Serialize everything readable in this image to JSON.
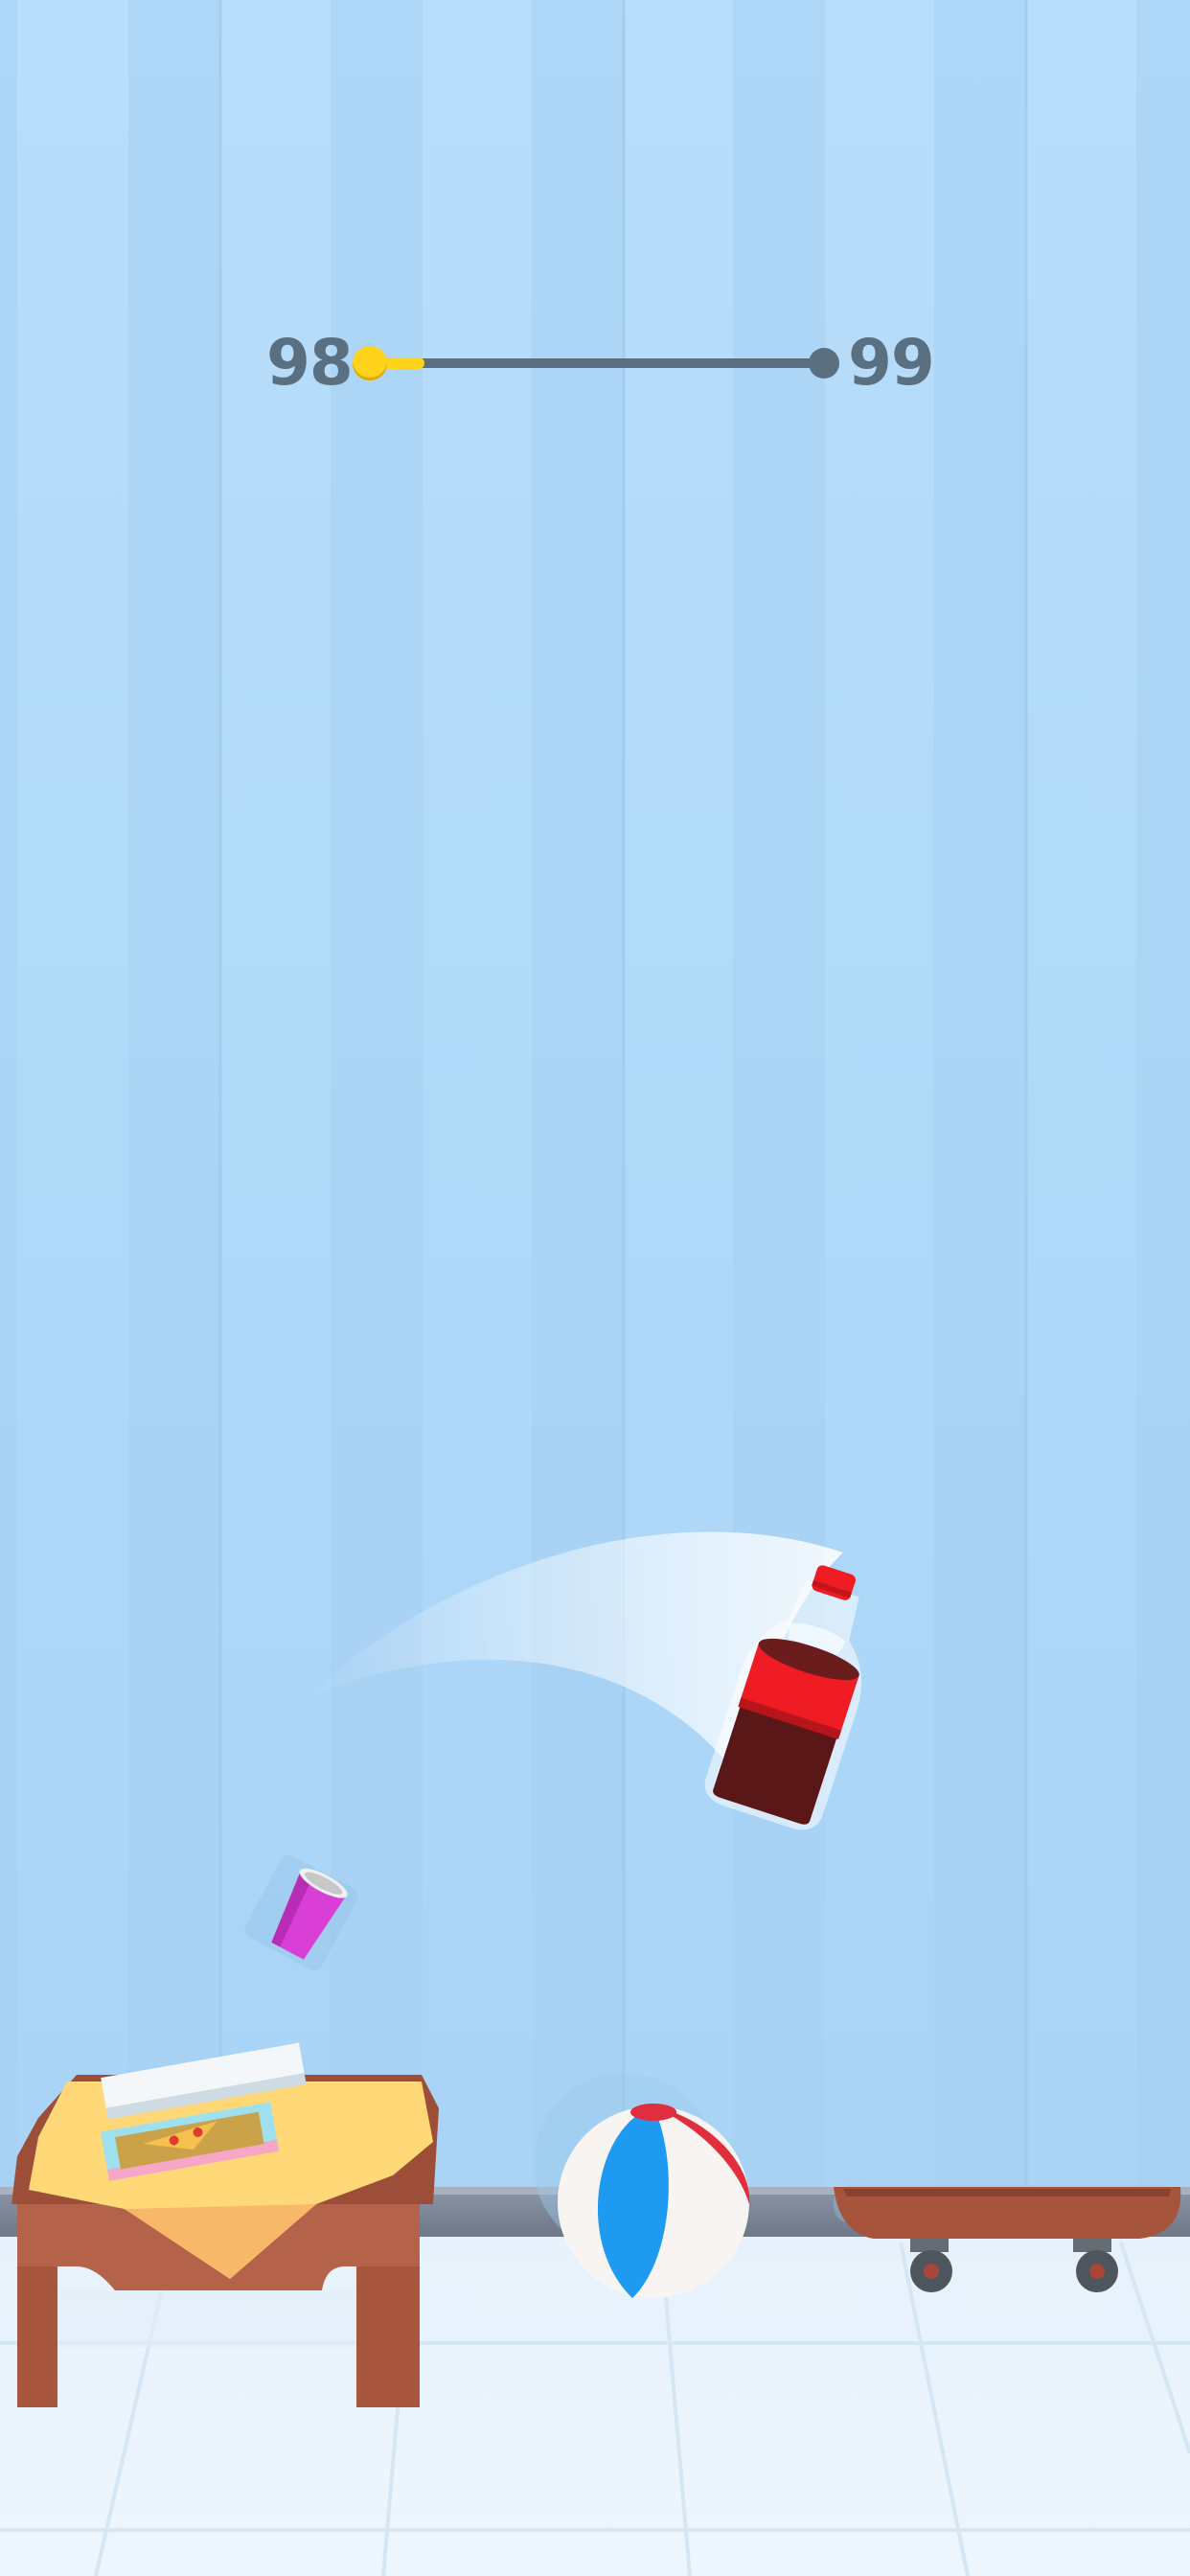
{
  "hud": {
    "current_level": "98",
    "next_level": "99",
    "progress_fraction": 0.12
  },
  "colors": {
    "wall": "#b9e0fb",
    "floor": "#eaf3fb",
    "progress_track": "#5a6f80",
    "progress_fill": "#ffd21c",
    "bottle_label": "#ef1c24",
    "cola": "#5a1717",
    "cup": "#d93fd6",
    "table": "#b4624a",
    "tablecloth": "#ffdb73",
    "skateboard": "#a6543b",
    "ball_blue": "#1e9bf0",
    "ball_red": "#e02e3f"
  },
  "scene": {
    "player": "cola-bottle",
    "targets": [
      "pink-cup",
      "pizza-box-table",
      "beach-ball",
      "skateboard"
    ]
  }
}
